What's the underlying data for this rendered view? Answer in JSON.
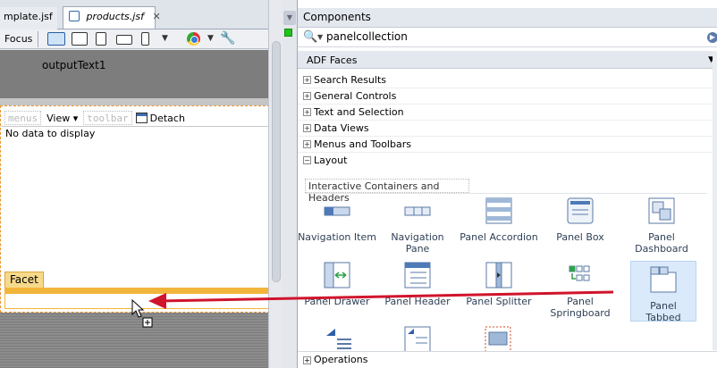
{
  "editor": {
    "tabs": [
      {
        "label": "mplate.jsf"
      },
      {
        "label": "products.jsf"
      }
    ],
    "toolbar": {
      "focus_label": "Focus"
    },
    "canvas": {
      "output_text": "outputText1",
      "panel_toolbar": {
        "menus": "menus",
        "view": "View",
        "toolbar": "toolbar",
        "detach": "Detach"
      },
      "empty_text": "No data to display",
      "facet_label": "Facet"
    }
  },
  "palette": {
    "title": "Components",
    "search_value": "panelcollection",
    "library": "ADF Faces",
    "categories": [
      {
        "label": "Search Results",
        "expanded": false
      },
      {
        "label": "General Controls",
        "expanded": false
      },
      {
        "label": "Text and Selection",
        "expanded": false
      },
      {
        "label": "Data Views",
        "expanded": false
      },
      {
        "label": "Menus and Toolbars",
        "expanded": false
      },
      {
        "label": "Layout",
        "expanded": true
      }
    ],
    "subsection": "Interactive Containers and Headers",
    "components": [
      {
        "label": "Navigation Item",
        "icon": "navigation-item-icon"
      },
      {
        "label": "Navigation Pane",
        "icon": "navigation-pane-icon"
      },
      {
        "label": "Panel Accordion",
        "icon": "panel-accordion-icon"
      },
      {
        "label": "Panel Box",
        "icon": "panel-box-icon"
      },
      {
        "label": "Panel Dashboard",
        "icon": "panel-dashboard-icon"
      },
      {
        "label": "Panel Drawer",
        "icon": "panel-drawer-icon"
      },
      {
        "label": "Panel Header",
        "icon": "panel-header-icon"
      },
      {
        "label": "Panel Splitter",
        "icon": "panel-splitter-icon"
      },
      {
        "label": "Panel Springboard",
        "icon": "panel-springboard-icon"
      },
      {
        "label": "Panel Tabbed",
        "icon": "panel-tabbed-icon",
        "highlighted": true
      }
    ],
    "operations": "Operations"
  },
  "colors": {
    "arrow": "#d0142c",
    "facet": "#f2b53c",
    "highlight": "#dbeafb"
  }
}
